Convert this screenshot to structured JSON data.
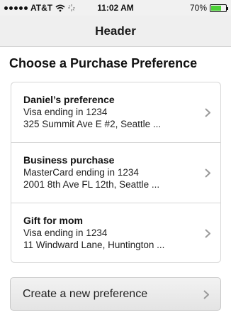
{
  "status_bar": {
    "carrier": "AT&T",
    "time": "11:02 AM",
    "battery": "70%",
    "battery_level": 0.7
  },
  "header": {
    "title": "Header"
  },
  "page": {
    "title": "Choose a Purchase Preference"
  },
  "preferences": [
    {
      "name": "Daniel’s preference",
      "card": "Visa ending in 1234",
      "address": "325 Summit Ave E #2, Seattle ..."
    },
    {
      "name": "Business purchase",
      "card": "MasterCard ending in 1234",
      "address": "2001 8th Ave FL 12th, Seattle ..."
    },
    {
      "name": "Gift for mom",
      "card": "Visa ending in 1234",
      "address": "11 Windward Lane, Huntington ..."
    }
  ],
  "create_button": {
    "label": "Create a new preference"
  },
  "icons": {
    "chevron": "chevron-right-icon",
    "wifi": "wifi-icon",
    "signal": "signal-icon",
    "battery": "battery-icon",
    "activity": "activity-icon"
  },
  "colors": {
    "battery_fill": "#4cd137",
    "header_bg": "#efefef"
  }
}
